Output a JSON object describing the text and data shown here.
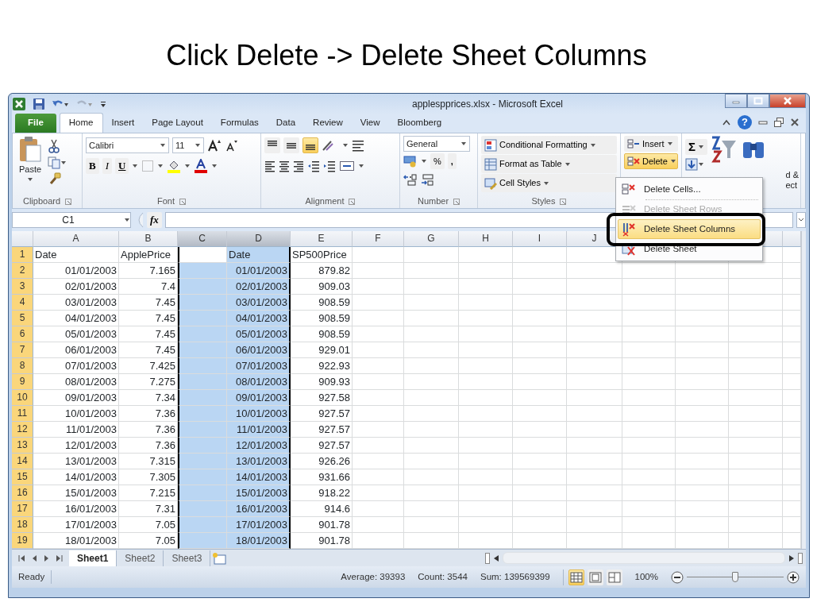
{
  "slide_title": "Click Delete -> Delete Sheet Columns",
  "window": {
    "title": "applespprices.xlsx - Microsoft Excel"
  },
  "ribbon_tabs": [
    {
      "label": "File",
      "kind": "file",
      "selected": false
    },
    {
      "label": "Home",
      "kind": "tab",
      "selected": true
    },
    {
      "label": "Insert",
      "kind": "tab",
      "selected": false
    },
    {
      "label": "Page Layout",
      "kind": "tab",
      "selected": false
    },
    {
      "label": "Formulas",
      "kind": "tab",
      "selected": false
    },
    {
      "label": "Data",
      "kind": "tab",
      "selected": false
    },
    {
      "label": "Review",
      "kind": "tab",
      "selected": false
    },
    {
      "label": "View",
      "kind": "tab",
      "selected": false
    },
    {
      "label": "Bloomberg",
      "kind": "tab",
      "selected": false
    }
  ],
  "help": "?",
  "ribbon": {
    "clipboard": {
      "paste": "Paste",
      "label": "Clipboard"
    },
    "font": {
      "name": "Calibri",
      "size": "11",
      "bold": "B",
      "italic": "I",
      "underline": "U",
      "label": "Font"
    },
    "alignment": {
      "vertical": [
        {
          "selected": false
        },
        {
          "selected": false
        },
        {
          "selected": true
        }
      ],
      "label": "Alignment"
    },
    "number": {
      "format": "General",
      "percent": "%",
      "comma": ",",
      "label": "Number"
    },
    "styles": {
      "buttons": [
        "Conditional Formatting",
        "Format as Table",
        "Cell Styles"
      ],
      "label": "Styles"
    },
    "cells": {
      "buttons": [
        {
          "label": "Insert",
          "selected": false
        },
        {
          "label": "Delete",
          "selected": true
        }
      ]
    },
    "editing": {
      "sum": "Σ",
      "fragments": [
        "d &",
        "ect"
      ]
    }
  },
  "delete_menu": [
    {
      "label": "Delete Cells...",
      "disabled": false,
      "selected": false
    },
    {
      "label": "Delete Sheet Rows",
      "disabled": true,
      "selected": false
    },
    {
      "label": "Delete Sheet Columns",
      "disabled": false,
      "selected": true
    },
    {
      "label": "Delete Sheet",
      "disabled": false,
      "selected": false
    }
  ],
  "formula_bar": {
    "name_box": "C1",
    "fx": "fx"
  },
  "columns": [
    {
      "letter": "A",
      "selected": false
    },
    {
      "letter": "B",
      "selected": false
    },
    {
      "letter": "C",
      "selected": true
    },
    {
      "letter": "D",
      "selected": true
    },
    {
      "letter": "E",
      "selected": false
    },
    {
      "letter": "F",
      "selected": false
    },
    {
      "letter": "G",
      "selected": false
    },
    {
      "letter": "H",
      "selected": false
    },
    {
      "letter": "I",
      "selected": false
    },
    {
      "letter": "J",
      "selected": false
    }
  ],
  "rows": [
    {
      "number": "1",
      "kind": "header",
      "cells": [
        "Date",
        "ApplePrice",
        "",
        "Date",
        "SP500Price"
      ]
    },
    {
      "number": "2",
      "kind": "data",
      "cells": [
        "01/01/2003",
        "7.165",
        "",
        "01/01/2003",
        "879.82"
      ]
    },
    {
      "number": "3",
      "kind": "data",
      "cells": [
        "02/01/2003",
        "7.4",
        "",
        "02/01/2003",
        "909.03"
      ]
    },
    {
      "number": "4",
      "kind": "data",
      "cells": [
        "03/01/2003",
        "7.45",
        "",
        "03/01/2003",
        "908.59"
      ]
    },
    {
      "number": "5",
      "kind": "data",
      "cells": [
        "04/01/2003",
        "7.45",
        "",
        "04/01/2003",
        "908.59"
      ]
    },
    {
      "number": "6",
      "kind": "data",
      "cells": [
        "05/01/2003",
        "7.45",
        "",
        "05/01/2003",
        "908.59"
      ]
    },
    {
      "number": "7",
      "kind": "data",
      "cells": [
        "06/01/2003",
        "7.45",
        "",
        "06/01/2003",
        "929.01"
      ]
    },
    {
      "number": "8",
      "kind": "data",
      "cells": [
        "07/01/2003",
        "7.425",
        "",
        "07/01/2003",
        "922.93"
      ]
    },
    {
      "number": "9",
      "kind": "data",
      "cells": [
        "08/01/2003",
        "7.275",
        "",
        "08/01/2003",
        "909.93"
      ]
    },
    {
      "number": "10",
      "kind": "data",
      "cells": [
        "09/01/2003",
        "7.34",
        "",
        "09/01/2003",
        "927.58"
      ]
    },
    {
      "number": "11",
      "kind": "data",
      "cells": [
        "10/01/2003",
        "7.36",
        "",
        "10/01/2003",
        "927.57"
      ]
    },
    {
      "number": "12",
      "kind": "data",
      "cells": [
        "11/01/2003",
        "7.36",
        "",
        "11/01/2003",
        "927.57"
      ]
    },
    {
      "number": "13",
      "kind": "data",
      "cells": [
        "12/01/2003",
        "7.36",
        "",
        "12/01/2003",
        "927.57"
      ]
    },
    {
      "number": "14",
      "kind": "data",
      "cells": [
        "13/01/2003",
        "7.315",
        "",
        "13/01/2003",
        "926.26"
      ]
    },
    {
      "number": "15",
      "kind": "data",
      "cells": [
        "14/01/2003",
        "7.305",
        "",
        "14/01/2003",
        "931.66"
      ]
    },
    {
      "number": "16",
      "kind": "data",
      "cells": [
        "15/01/2003",
        "7.215",
        "",
        "15/01/2003",
        "918.22"
      ]
    },
    {
      "number": "17",
      "kind": "data",
      "cells": [
        "16/01/2003",
        "7.31",
        "",
        "16/01/2003",
        "914.6"
      ]
    },
    {
      "number": "18",
      "kind": "data",
      "cells": [
        "17/01/2003",
        "7.05",
        "",
        "17/01/2003",
        "901.78"
      ]
    },
    {
      "number": "19",
      "kind": "data",
      "cells": [
        "18/01/2003",
        "7.05",
        "",
        "18/01/2003",
        "901.78"
      ]
    }
  ],
  "sheet_tabs": [
    {
      "label": "Sheet1",
      "selected": true
    },
    {
      "label": "Sheet2",
      "selected": false
    },
    {
      "label": "Sheet3",
      "selected": false
    }
  ],
  "status_bar": {
    "mode": "Ready",
    "stats": [
      "Average: 39393",
      "Count: 3544",
      "Sum: 139569399"
    ],
    "views": [
      {
        "selected": true
      },
      {
        "selected": false
      },
      {
        "selected": false
      }
    ],
    "zoom": "100%",
    "zoom_slider": {
      "level": 0.5
    }
  }
}
